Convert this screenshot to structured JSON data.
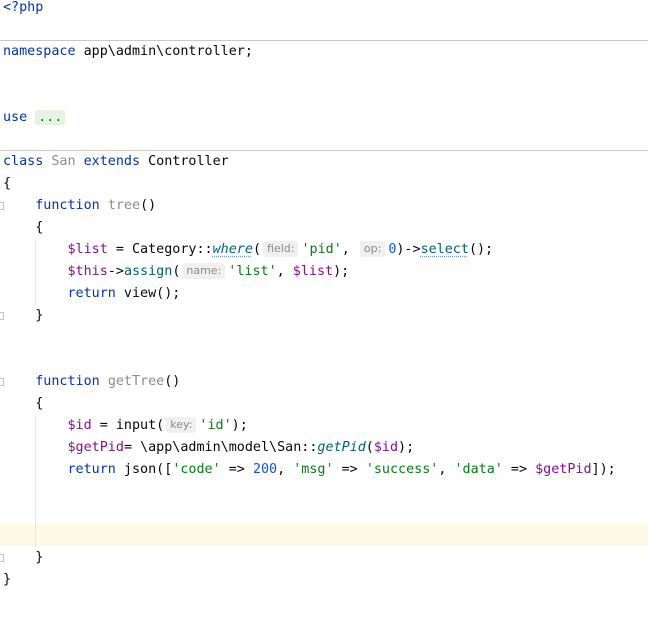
{
  "editor": {
    "l1_open": "<?php",
    "l2_kw": "namespace",
    "l2_rest": " app\\admin\\controller;",
    "l3_kw": "use",
    "l3_fold": "...",
    "l4_kw": "class",
    "l4_name": "San",
    "l4_ext": "extends",
    "l4_parent": "Controller",
    "brace_open": "{",
    "brace_close": "}",
    "fn_kw": "function",
    "tree_name": "tree",
    "parens": "()",
    "list_var": "$list",
    "eq_cat": " = Category::",
    "where_call": "where",
    "paren_open": "(",
    "hint_field": "field:",
    "pid_str": "'pid'",
    "comma_sp": ", ",
    "hint_op": "op:",
    "zero": "0",
    "close_arrow": ")->",
    "select_call": "select",
    "close_semi": "();",
    "this_var": "$this",
    "arrow": "->",
    "assign_call": "assign",
    "hint_name": "name:",
    "list_str": "'list'",
    "paren_semi": ");",
    "return_kw": "return",
    "view_call": " view();",
    "gettree_name": "getTree",
    "id_var": "$id",
    "input_call": " = input(",
    "hint_key": "key:",
    "id_str": "'id'",
    "getpid_var": "$getPid",
    "model_path": "= \\app\\admin\\model\\San::",
    "getpid_call": "getPid",
    "json_open": " json([",
    "code_str": "'code'",
    "fat_arrow": " => ",
    "num_200": "200",
    "msg_str": "'msg'",
    "success_str": "'success'",
    "data_str": "'data'",
    "json_close": "]);"
  }
}
